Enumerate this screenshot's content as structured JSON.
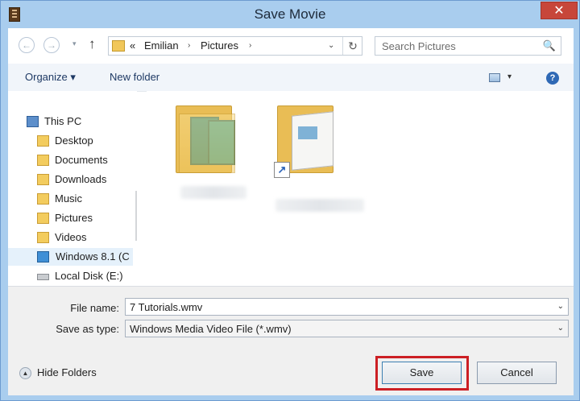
{
  "window": {
    "title": "Save Movie",
    "close_glyph": "✕"
  },
  "navigation": {
    "back_glyph": "←",
    "forward_glyph": "→",
    "recent_glyph": "▾",
    "up_glyph": "↑",
    "address": {
      "overflow": "«",
      "segments": [
        "Emilian",
        "Pictures"
      ],
      "separator": "›",
      "dropdown_glyph": "⌄",
      "refresh_glyph": "↻"
    },
    "search": {
      "placeholder": "Search Pictures",
      "icon": "🔍"
    }
  },
  "toolbar": {
    "organize_label": "Organize ▾",
    "new_folder_label": "New folder",
    "view_drop_glyph": "▾",
    "help_glyph": "?"
  },
  "nav_pane": {
    "items": [
      {
        "label": "This PC",
        "icon": "pc-icon"
      },
      {
        "label": "Desktop",
        "icon": "folder-icon"
      },
      {
        "label": "Documents",
        "icon": "folder-icon"
      },
      {
        "label": "Downloads",
        "icon": "folder-icon"
      },
      {
        "label": "Music",
        "icon": "folder-icon"
      },
      {
        "label": "Pictures",
        "icon": "folder-icon"
      },
      {
        "label": "Videos",
        "icon": "folder-icon"
      },
      {
        "label": "Windows 8.1 (C",
        "icon": "windows-drive-icon",
        "selected": true
      },
      {
        "label": "Local Disk (E:)",
        "icon": "disk-icon"
      }
    ],
    "scroll_up_glyph": "⌃",
    "scroll_down_glyph": "⌄"
  },
  "files": [
    {
      "icon": "picture-folder-icon",
      "label_blurred": true
    },
    {
      "icon": "document-folder-shortcut-icon",
      "label_blurred": true,
      "shortcut_glyph": "↗"
    }
  ],
  "form": {
    "file_name_label": "File name:",
    "file_name_value": "7 Tutorials.wmv",
    "save_as_type_label": "Save as type:",
    "save_as_type_value": "Windows Media Video File (*.wmv)",
    "dropdown_glyph": "⌄"
  },
  "footer": {
    "hide_folders_label": "Hide Folders",
    "hide_folders_glyph": "▲",
    "save_label": "Save",
    "cancel_label": "Cancel",
    "highlight_color": "#cc1f24"
  }
}
